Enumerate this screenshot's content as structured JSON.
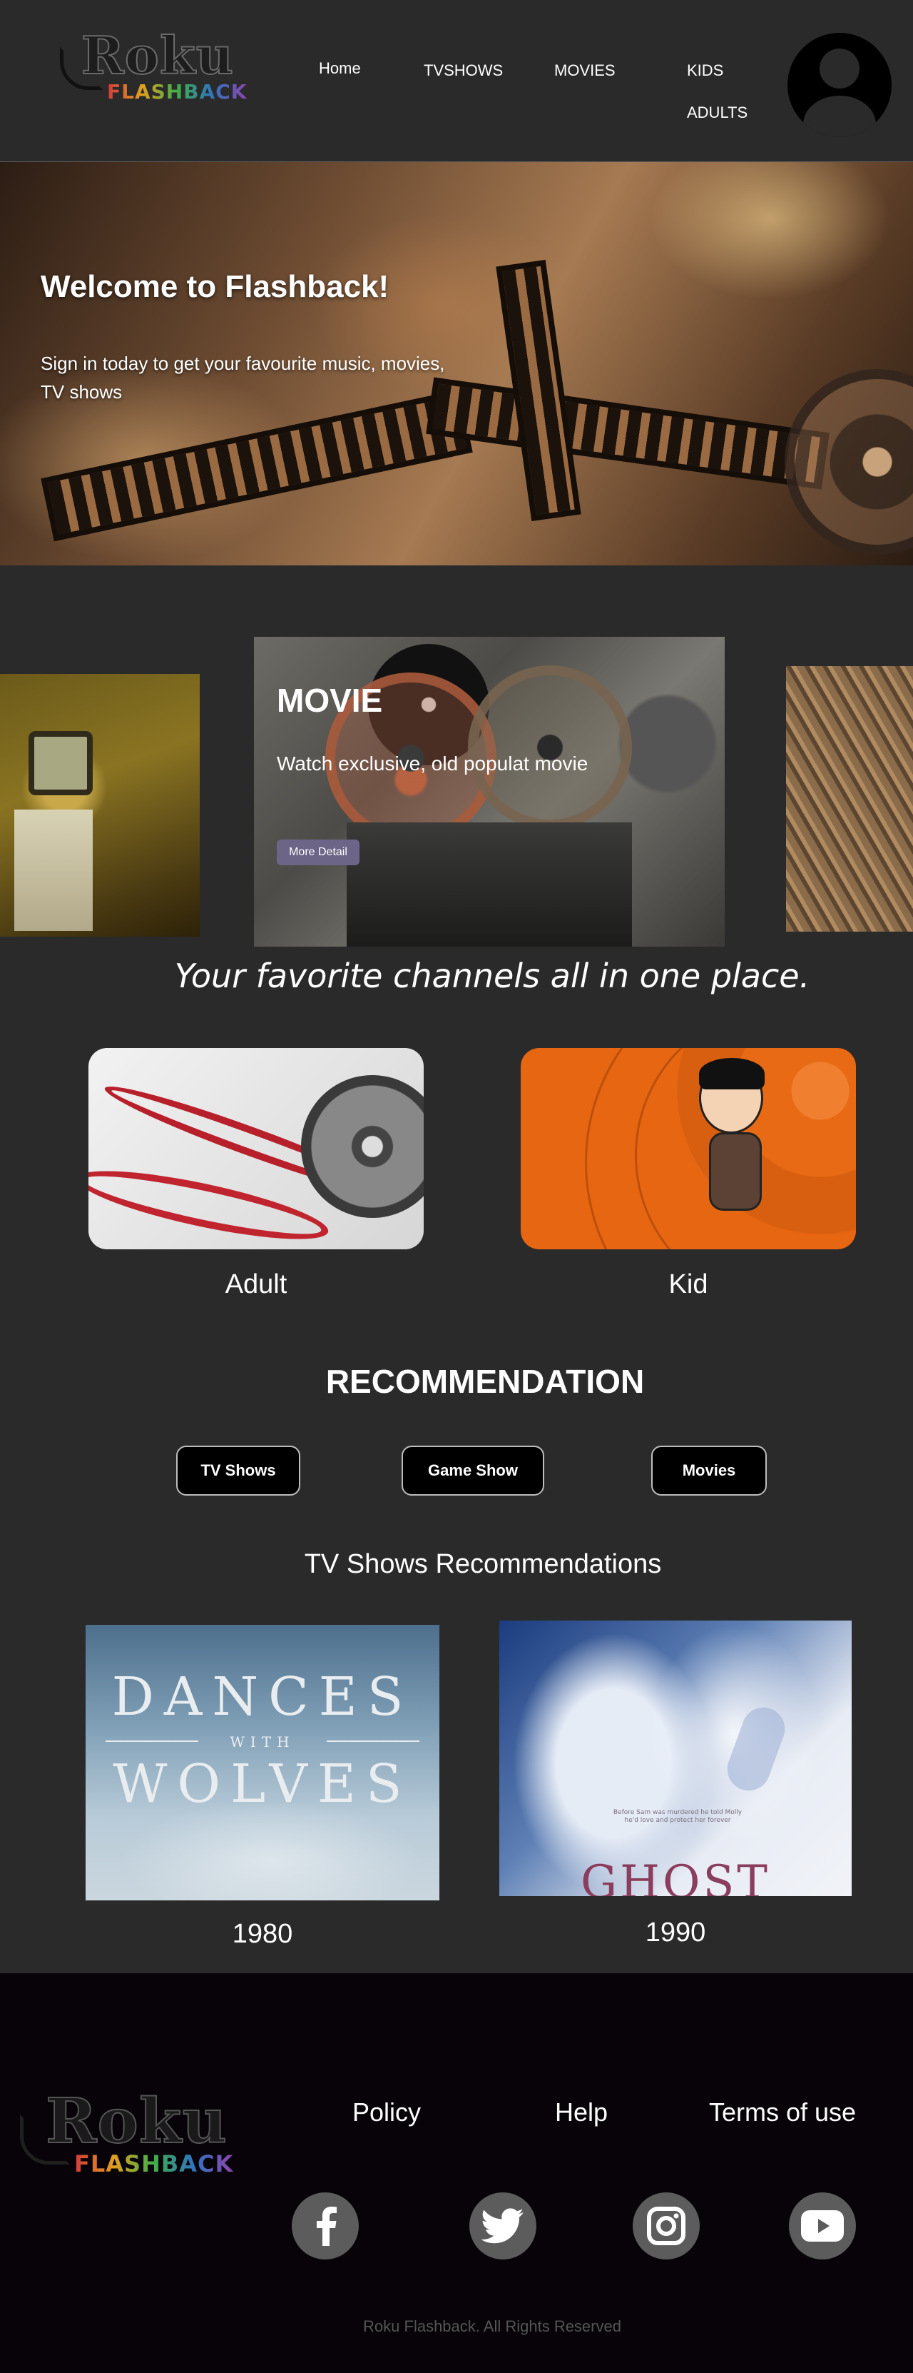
{
  "header": {
    "logo": {
      "main": "Roku",
      "sub": "FLASHBACK"
    },
    "nav": [
      {
        "label": "Home"
      },
      {
        "label": "TVSHOWS"
      },
      {
        "label": "MOVIES"
      },
      {
        "label": "KIDS"
      },
      {
        "label": "ADULTS"
      }
    ],
    "avatar_icon": "user-avatar-icon"
  },
  "hero": {
    "title": "Welcome to Flashback!",
    "subtitle": "Sign in today to get your favourite music, movies, TV shows"
  },
  "carousel": {
    "active_slide": {
      "title": "MOVIE",
      "text": "Watch exclusive, old populat movie",
      "button": "More Detail"
    }
  },
  "tagline": "Your favorite channels all in one place.",
  "categories": [
    {
      "label": "Adult"
    },
    {
      "label": "Kid"
    }
  ],
  "recommendation": {
    "title": "RECOMMENDATION",
    "tabs": [
      {
        "label": "TV Shows"
      },
      {
        "label": "Game Show"
      },
      {
        "label": "Movies"
      }
    ],
    "section_title": "TV Shows Recommendations",
    "items": [
      {
        "poster_line1": "DANCES",
        "poster_with": "WITH",
        "poster_line2": "WOLVES",
        "year": "1980"
      },
      {
        "poster_text": "Before Sam was murdered he told Molly he'd love and protect her forever",
        "poster_title": "GHOST",
        "year": "1990"
      }
    ]
  },
  "footer": {
    "logo": {
      "main": "Roku",
      "sub": "FLASHBACK"
    },
    "links": [
      {
        "label": "Policy"
      },
      {
        "label": "Help"
      },
      {
        "label": "Terms of use"
      }
    ],
    "social": [
      {
        "icon": "facebook-icon"
      },
      {
        "icon": "twitter-icon"
      },
      {
        "icon": "instagram-icon"
      },
      {
        "icon": "youtube-icon"
      }
    ],
    "copyright": "Roku Flashback. All Rights Reserved"
  },
  "colors": {
    "background": "#2a2a2a",
    "footer": "#070308",
    "button_accent": "#6c6587",
    "kid_card": "#e66612"
  }
}
